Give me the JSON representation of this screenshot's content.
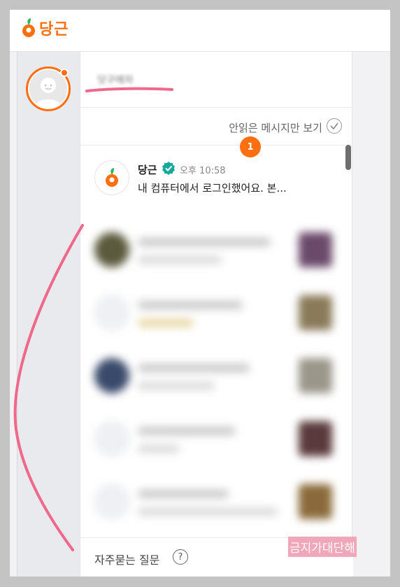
{
  "app": {
    "logo_text": "당근",
    "brand_color": "#ff6f0f",
    "accent_pink": "#f0688a"
  },
  "profile": {
    "username": "닷구매자",
    "avatar_icon": "default-user-avatar-icon",
    "online_dot": true
  },
  "filter": {
    "label": "안읽은 메시지만 보기",
    "icon": "check-circle-icon"
  },
  "chats": [
    {
      "name": "당근",
      "verified_icon": "verified-badge-icon",
      "time": "오후 10:58",
      "message": "내 컴퓨터에서 로그인했어요. 본...",
      "unread": "1",
      "avatar_icon": "carrot-logo-icon"
    }
  ],
  "footer": {
    "faq_label": "자주묻는 질문",
    "faq_icon_glyph": "?"
  },
  "watermark": {
    "text": "금지가대단해"
  }
}
